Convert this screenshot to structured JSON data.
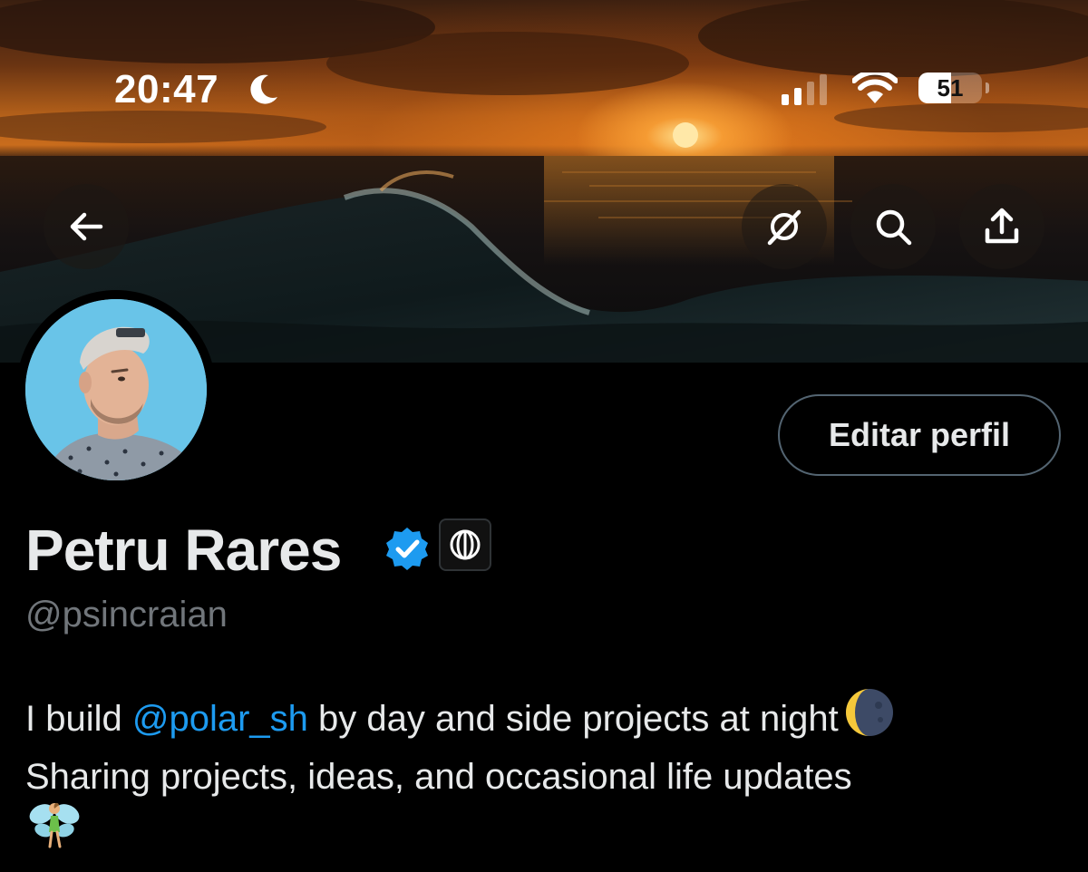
{
  "status_bar": {
    "time": "20:47",
    "battery_level": "51",
    "battery_fraction": 0.51
  },
  "header": {
    "back_icon": "arrow-left-icon",
    "grok_icon": "grok-icon",
    "search_icon": "search-icon",
    "share_icon": "share-icon"
  },
  "profile": {
    "edit_label": "Editar perfil",
    "name": "Petru Rares",
    "handle": "@psincraian",
    "bio_line1_before": "I build ",
    "bio_mention": "@polar_sh",
    "bio_line1_after": " by day and side projects at night",
    "bio_line2": "Sharing projects, ideas, and occasional life updates"
  },
  "colors": {
    "background": "#000000",
    "text": "#e7e9ea",
    "muted": "#71767b",
    "accent": "#1d9bf0",
    "border": "#536471"
  }
}
